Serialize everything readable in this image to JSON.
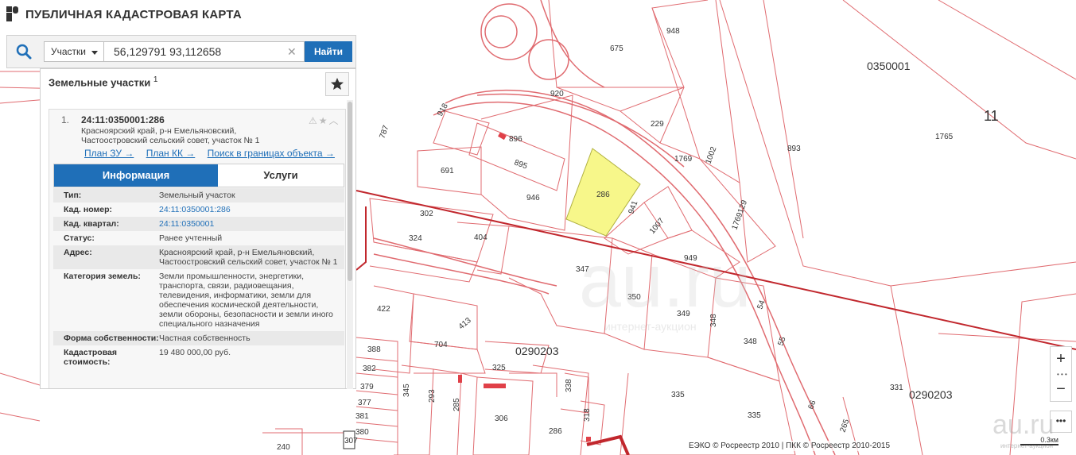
{
  "header": {
    "title": "ПУБЛИЧНАЯ КАДАСТРОВАЯ КАРТА",
    "logo_icon": "pkk-logo"
  },
  "search": {
    "type_label": "Участки",
    "query": "56,129791 93,112658",
    "button": "Найти",
    "search_icon": "search-icon"
  },
  "panel": {
    "title": "Земельные участки",
    "count_sup": "1",
    "result": {
      "index": "1.",
      "cad_number": "24:11:0350001:286",
      "address": "Красноярский край, р-н Емельяновский, Частоостровский сельский совет, участок № 1",
      "links": [
        "План ЗУ →",
        "План КК →",
        "Поиск в границах объекта →"
      ],
      "tabs": [
        "Информация",
        "Услуги"
      ],
      "info": [
        {
          "key": "Тип:",
          "value": "Земельный участок",
          "link": false
        },
        {
          "key": "Кад. номер:",
          "value": "24:11:0350001:286",
          "link": true
        },
        {
          "key": "Кад. квартал:",
          "value": "24:11:0350001",
          "link": true
        },
        {
          "key": "Статус:",
          "value": "Ранее учтенный",
          "link": false
        },
        {
          "key": "Адрес:",
          "value": "Красноярский край, р-н Емельяновский, Частоостровский сельский совет, участок № 1",
          "link": false
        },
        {
          "key": "Категория земель:",
          "value": "Земли промышленности, энергетики, транспорта, связи, радиовещания, телевидения, информатики, земли для обеспечения космической деятельности, земли обороны, безопасности и земли иного специального назначения",
          "link": false
        },
        {
          "key": "Форма собственности:",
          "value": "Частная собственность",
          "link": false
        },
        {
          "key": "Кадастровая стоимость:",
          "value": "19 480 000,00 руб.",
          "link": false
        }
      ]
    }
  },
  "map": {
    "selected_parcel": "286",
    "highlight_color": "#f7f78a",
    "boundary_color": "#d9363e",
    "quarters": [
      "0350001",
      "0290203",
      "0290203",
      "11"
    ],
    "parcels": [
      "948",
      "675",
      "920",
      "229",
      "1769",
      "1002",
      "893",
      "1765",
      "896",
      "895",
      "691",
      "946",
      "941",
      "1007",
      "949",
      "1769129",
      "302",
      "324",
      "404",
      "347",
      "350",
      "349",
      "348",
      "348",
      "422",
      "413",
      "704",
      "325",
      "388",
      "382",
      "379",
      "377",
      "381",
      "380",
      "307",
      "240",
      "345",
      "293",
      "285",
      "306",
      "338",
      "318",
      "286",
      "335",
      "335",
      "331",
      "787",
      "918",
      "54",
      "55",
      "66",
      "265"
    ],
    "watermark": "au.ru",
    "watermark_sub": "интернет-аукцион"
  },
  "controls": {
    "zoom_in": "+",
    "zoom_out": "−",
    "zoom_dots": "• • •",
    "more": "•••"
  },
  "footer": {
    "attribution": "ЕЭКО © Росреестр 2010 | ПКК © Росреестр 2010-2015",
    "scale": "0.3км"
  }
}
